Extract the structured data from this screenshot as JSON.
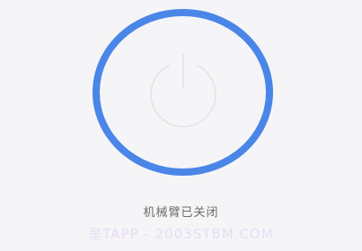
{
  "power_button": {
    "icon": "power-icon",
    "ring_color": "#4a86e8",
    "icon_color": "#e2e2e4"
  },
  "status": {
    "label": "机械臂已关闭"
  },
  "watermark": {
    "text": "是TAPP - 2003STBM.COM"
  }
}
